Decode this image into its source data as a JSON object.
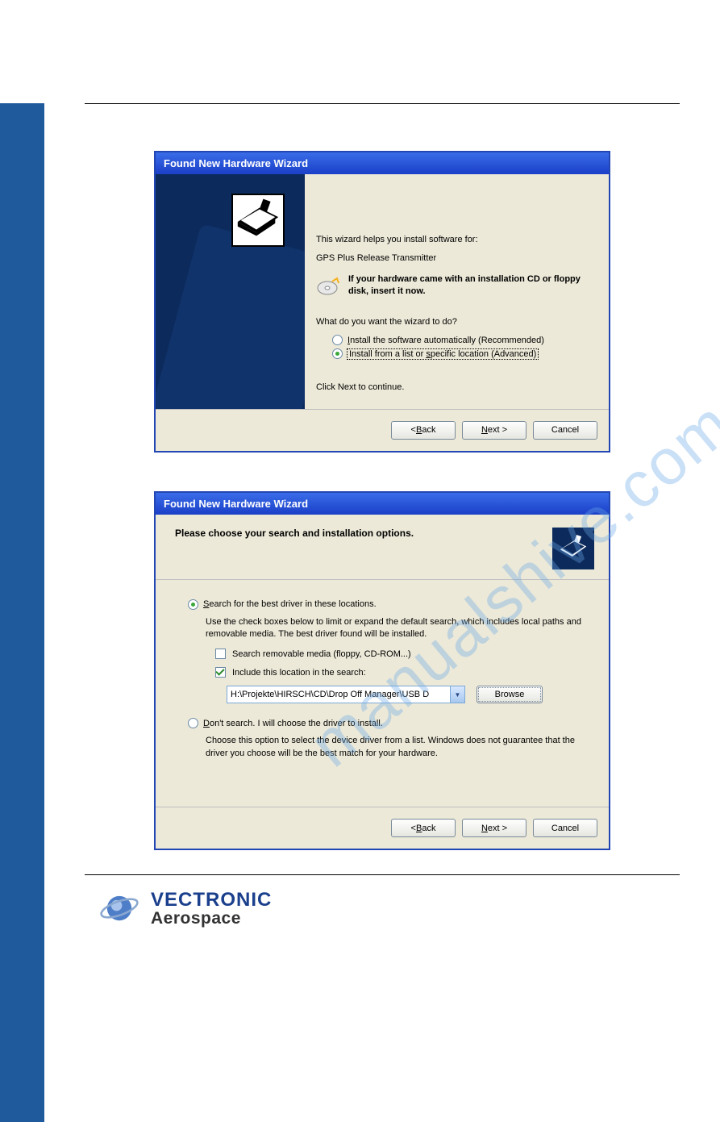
{
  "watermark": "manualshive.com",
  "dialog1": {
    "title": "Found New Hardware Wizard",
    "intro": "This wizard helps you install software for:",
    "device": "GPS Plus Release Transmitter",
    "cd_bold": "If your hardware came with an installation CD or floppy disk, insert it now.",
    "question": "What do you want the wizard to do?",
    "opt_auto": "Install the software automatically (Recommended)",
    "opt_adv": "Install from a list or specific location (Advanced)",
    "click_next": "Click Next to continue.",
    "btn_back": "< Back",
    "btn_next": "Next >",
    "btn_cancel": "Cancel"
  },
  "dialog2": {
    "title": "Found New Hardware Wizard",
    "heading": "Please choose your search and installation options.",
    "opt_search": "Search for the best driver in these locations.",
    "search_sub": "Use the check boxes below to limit or expand the default search, which includes local paths and removable media. The best driver found will be installed.",
    "chk_removable": "Search removable media (floppy, CD-ROM...)",
    "chk_include": "Include this location in the search:",
    "path": "H:\\Projekte\\HIRSCH\\CD\\Drop Off Manager\\USB D",
    "browse": "Browse",
    "opt_dontsearch": "Don't search. I will choose the driver to install.",
    "dont_sub": "Choose this option to select the device driver from a list.  Windows does not guarantee that the driver you choose will be the best match for your hardware.",
    "btn_back": "< Back",
    "btn_next": "Next >",
    "btn_cancel": "Cancel"
  },
  "footer": {
    "line1": "VECTRONIC",
    "line2": "Aerospace"
  }
}
